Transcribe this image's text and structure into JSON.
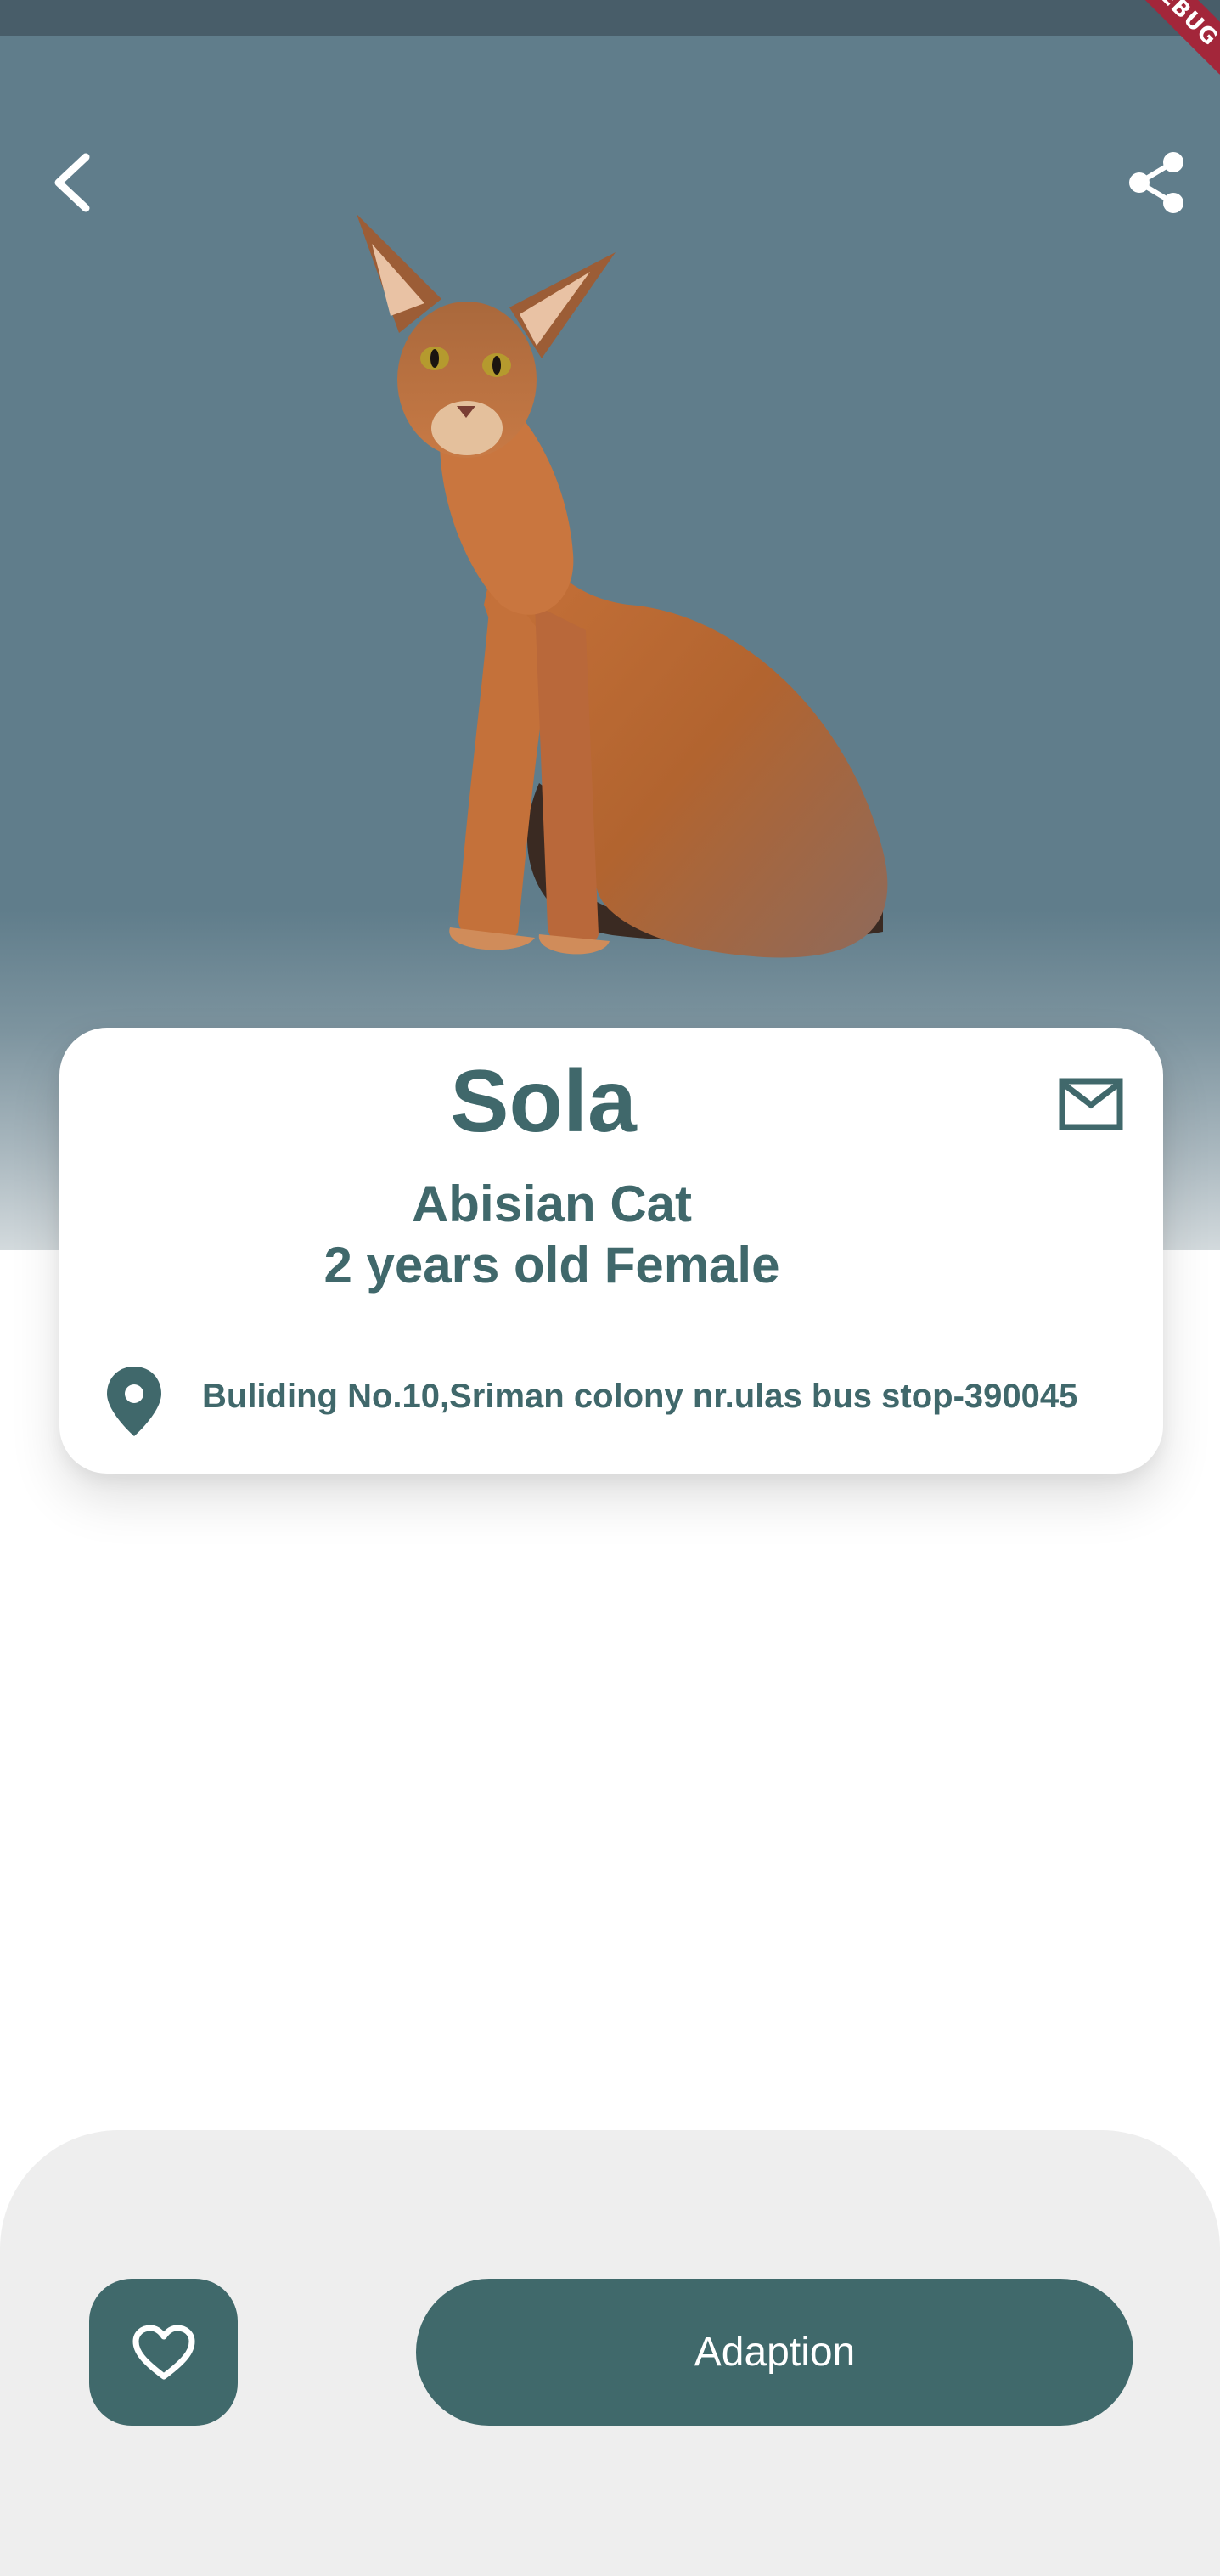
{
  "app": {
    "debug_banner": "DEBUG"
  },
  "header": {
    "back_icon": "chevron-left-icon",
    "share_icon": "share-icon"
  },
  "pet": {
    "image": "abyssinian-cat-photo",
    "name": "Sola",
    "breed": "Abisian Cat",
    "age_gender": "2 years old Female",
    "address": "Buliding No.10,Sriman colony nr.ulas bus stop-390045"
  },
  "card": {
    "mail_icon": "mail-icon",
    "location_icon": "location-pin-icon"
  },
  "actions": {
    "favorite_icon": "heart-outline-icon",
    "adopt_label": "Adaption"
  },
  "colors": {
    "hero_background": "#607d8b",
    "accent": "#40696b",
    "bottom_panel": "#eeeeee",
    "debug_banner": "#a3263a"
  }
}
